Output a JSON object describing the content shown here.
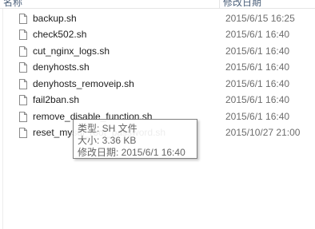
{
  "header": {
    "name_col": "名称",
    "date_col": "修改日期"
  },
  "files": [
    {
      "name": "backup.sh",
      "date": "2015/6/15 16:25"
    },
    {
      "name": "check502.sh",
      "date": "2015/6/1 16:40"
    },
    {
      "name": "cut_nginx_logs.sh",
      "date": "2015/6/1 16:40"
    },
    {
      "name": "denyhosts.sh",
      "date": "2015/6/1 16:40"
    },
    {
      "name": "denyhosts_removeip.sh",
      "date": "2015/6/1 16:40"
    },
    {
      "name": "fail2ban.sh",
      "date": "2015/6/1 16:40"
    },
    {
      "name": "remove_disable_function.sh",
      "date": "2015/6/1 16:40"
    },
    {
      "name": "reset_mysql_root_password.sh",
      "date": "2015/10/27 21:00"
    }
  ],
  "tooltip": {
    "type_line": "类型: SH 文件",
    "size_line": "大小: 3.36 KB",
    "modified_line": "修改日期: 2015/6/1 16:40"
  },
  "icons": {
    "file": "file-icon"
  }
}
